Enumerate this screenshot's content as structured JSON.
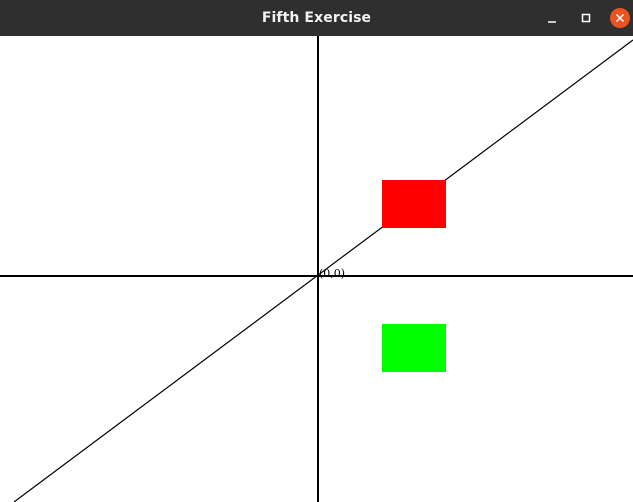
{
  "window": {
    "title": "Fifth Exercise"
  },
  "icons": {
    "minimize": "minimize-icon",
    "maximize": "maximize-icon",
    "close": "close-icon"
  },
  "colors": {
    "titlebar": "#2f2f2f",
    "close_button": "#e95420",
    "red_rect": "#ff0000",
    "green_rect": "#00ff00",
    "lines": "#000000"
  },
  "canvas": {
    "origin_label": "(0,0)"
  }
}
